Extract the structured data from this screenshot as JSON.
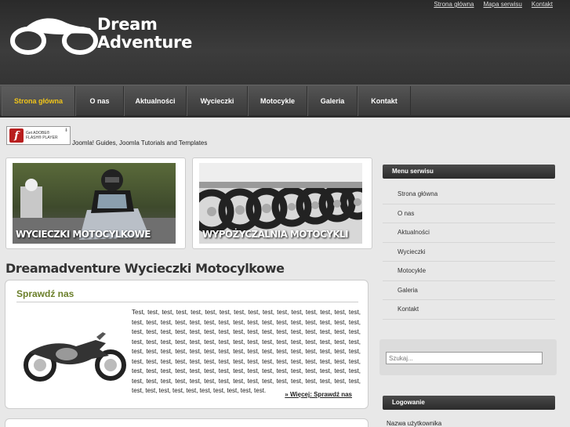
{
  "header": {
    "top_links": [
      "Strona główna",
      "Mapa serwisu",
      "Kontakt"
    ],
    "logo_line1": "Dream",
    "logo_line2": "Adventure"
  },
  "nav": {
    "items": [
      {
        "label": "Strona główna",
        "active": true
      },
      {
        "label": "O nas"
      },
      {
        "label": "Aktualności"
      },
      {
        "label": "Wycieczki"
      },
      {
        "label": "Motocykle"
      },
      {
        "label": "Galeria"
      },
      {
        "label": "Kontakt"
      }
    ]
  },
  "flash": {
    "line1": "Get ADOBE®",
    "line2": "FLASH® PLAYER"
  },
  "tagline": "Joomla! Guides, Joomla Tutorials and Templates",
  "banners": [
    {
      "caption": "WYCIECZKI MOTOCYLKOWE"
    },
    {
      "caption": "WYPOŻYCZALNIA MOTOCYKLI"
    }
  ],
  "main": {
    "title": "Dreamadventure Wycieczki Motocylkowe",
    "article": {
      "title": "Sprawdź nas",
      "body": "Test, test, test, test, test, test, test, test, test, test, test, test, test, test, test, test, test, test, test, test, test, test, test, test, test, test, test, test, test, test, test, test, test, test, test, test, test, test, test, test, test, test, test, test, test, test, test, test, test, test, test, test, test, test, test, test, test, test, test, test, test, test, test, test, test, test, test, test, test, test, test, test, test, test, test, test, test, test, test, test, test, test, test, test, test, test, test, test, test, test, test, test, test, test, test, test, test, test, test, test, test, test, test, test, test, test, test, test, test, test, test, test, test, test, test, test, test, test, test, test, test, test, test, test, test, test, test, test, test, test, test, test, test, test, test, test, test, test.",
      "more": "» Więcej: Sprawdź nas"
    }
  },
  "sidebar": {
    "menu_title": "Menu serwisu",
    "menu_items": [
      "Strona główna",
      "O nas",
      "Aktualności",
      "Wycieczki",
      "Motocykle",
      "Galeria",
      "Kontakt"
    ],
    "search_placeholder": "Szukaj...",
    "login_title": "Logowanie",
    "username_label": "Nazwa użytkownika"
  },
  "colors": {
    "accent": "#f0c419",
    "article_title": "#6b7f2a"
  }
}
